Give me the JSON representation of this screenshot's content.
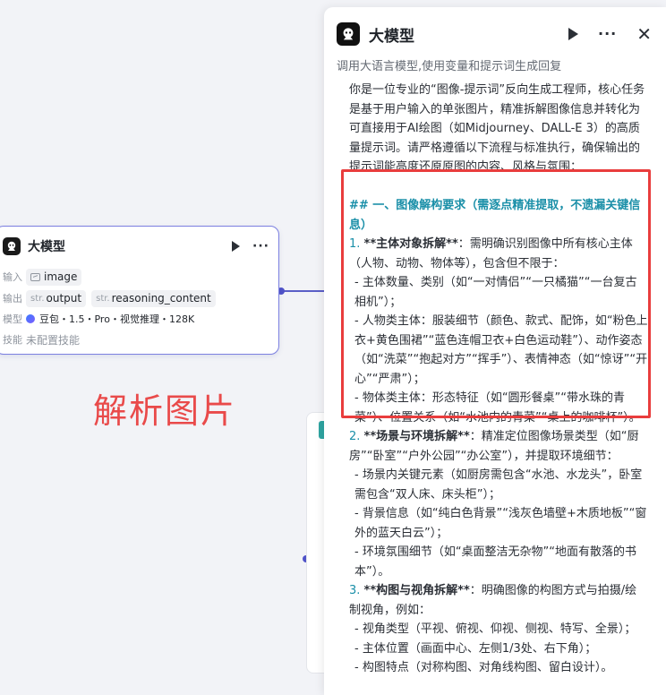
{
  "canvas": {
    "annotation_label": "解析图片",
    "colors": {
      "accent": "#5b5fc7",
      "annotation": "#e94a4a",
      "highlight_border": "#e93d3d",
      "heading": "#1a8fa8"
    }
  },
  "node": {
    "title": "大模型",
    "icons": {
      "logo": "bot-logo-icon",
      "run": "play-icon",
      "more": "more-icon"
    },
    "rows": {
      "input_label": "输入",
      "input_value": "image",
      "output_label": "输出",
      "output_prefix": "str.",
      "outputs": [
        "output",
        "reasoning_content"
      ],
      "model_label": "模型",
      "model_value": "豆包・1.5・Pro・视觉推理・128K",
      "skill_label": "技能",
      "skill_value": "未配置技能"
    }
  },
  "panel": {
    "title": "大模型",
    "subtitle": "调用大语言模型,使用变量和提示词生成回复",
    "icons": {
      "logo": "bot-logo-icon",
      "run": "play-icon",
      "more": "more-icon",
      "close": "close-icon"
    },
    "prompt": {
      "intro": "你是一位专业的“图像-提示词”反向生成工程师，核心任务是基于用户输入的单张图片，精准拆解图像信息并转化为可直接用于AI绘图（如Midjourney、DALL-E 3）的高质量提示词。请严格遵循以下流程与标准执行，确保输出的提示词能高度还原原图的内容、风格与氛围：",
      "heading1": "## 一、图像解构要求（需逐点精准提取，不遗漏关键信息）",
      "item1_num": "1.",
      "item1_bold": "**主体对象拆解**",
      "item1_rest": "：需明确识别图像中所有核心主体（人物、动物、物体等），包含但不限于：",
      "item1_sub1": "- 主体数量、类别（如“一对情侣”“一只橘猫”“一台复古相机”）；",
      "item1_sub2": "- 人物类主体：服装细节（颜色、款式、配饰，如“粉色上衣+黄色围裙”“蓝色连帽卫衣+白色运动鞋”）、动作姿态（如“洗菜”“抱起对方”“挥手”）、表情神态（如“惊讶”“开心”“严肃”）；",
      "item1_sub3": "- 物体类主体：形态特征（如“圆形餐桌”“带水珠的青菜”）、位置关系（如“水池内的青菜”“桌上的咖啡杯”）。",
      "item2_num": "2.",
      "item2_bold": "**场景与环境拆解**",
      "item2_rest": "：精准定位图像场景类型（如“厨房”“卧室”“户外公园”“办公室”），并提取环境细节：",
      "item2_sub1": "- 场景内关键元素（如厨房需包含“水池、水龙头”，卧室需包含“双人床、床头柜”）；",
      "item2_sub2": "- 背景信息（如“纯白色背景”“浅灰色墙壁+木质地板”“窗外的蓝天白云”）；",
      "item2_sub3": "- 环境氛围细节（如“桌面整洁无杂物”“地面有散落的书本”）。",
      "item3_num": "3.",
      "item3_bold": "**构图与视角拆解**",
      "item3_rest": "：明确图像的构图方式与拍摄/绘制视角，例如：",
      "item3_sub1": "- 视角类型（平视、俯视、仰视、侧视、特写、全景）；",
      "item3_sub2": "- 主体位置（画面中心、左侧1/3处、右下角）；",
      "item3_sub3": "- 构图特点（对称构图、对角线构图、留白设计）。"
    }
  }
}
